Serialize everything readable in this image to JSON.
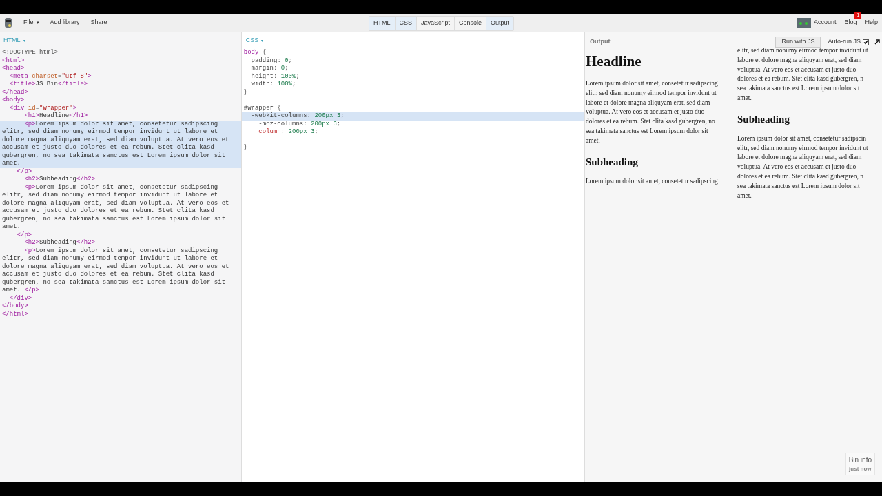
{
  "toolbar": {
    "menu": [
      {
        "label": "File",
        "caret": "▾"
      },
      {
        "label": "Add library"
      },
      {
        "label": "Share"
      }
    ],
    "tabs": [
      {
        "label": "HTML",
        "selected": true
      },
      {
        "label": "CSS",
        "selected": true
      },
      {
        "label": "JavaScript",
        "selected": false
      },
      {
        "label": "Console",
        "selected": false
      },
      {
        "label": "Output",
        "selected": true
      }
    ],
    "account": "Account",
    "blog": "Blog",
    "blog_badge": "1",
    "help": "Help"
  },
  "html_panel": {
    "title": "HTML",
    "caret": "▾",
    "lines": [
      {
        "highlighted": false,
        "tokens": [
          {
            "kind": "plain",
            "text": "<!DOCTYPE html>"
          }
        ]
      },
      {
        "highlighted": false,
        "tokens": [
          {
            "kind": "tag",
            "text": "<html>"
          }
        ]
      },
      {
        "highlighted": false,
        "tokens": [
          {
            "kind": "tag",
            "text": "<head>"
          }
        ]
      },
      {
        "highlighted": false,
        "tokens": [
          {
            "kind": "tag",
            "text": "  <meta "
          },
          {
            "kind": "attr",
            "text": "charset"
          },
          {
            "kind": "plain",
            "text": "="
          },
          {
            "kind": "string",
            "text": "\"utf-8\""
          },
          {
            "kind": "tag",
            "text": ">"
          }
        ]
      },
      {
        "highlighted": false,
        "tokens": [
          {
            "kind": "tag",
            "text": "  <title>"
          },
          {
            "kind": "text",
            "text": "JS Bin"
          },
          {
            "kind": "tag",
            "text": "</title>"
          }
        ]
      },
      {
        "highlighted": false,
        "tokens": [
          {
            "kind": "tag",
            "text": "</head>"
          }
        ]
      },
      {
        "highlighted": false,
        "tokens": [
          {
            "kind": "tag",
            "text": "<body>"
          }
        ]
      },
      {
        "highlighted": false,
        "tokens": [
          {
            "kind": "tag",
            "text": "  <div "
          },
          {
            "kind": "attr",
            "text": "id"
          },
          {
            "kind": "plain",
            "text": "="
          },
          {
            "kind": "string",
            "text": "\"wrapper\""
          },
          {
            "kind": "tag",
            "text": ">"
          }
        ]
      },
      {
        "highlighted": false,
        "tokens": [
          {
            "kind": "tag",
            "text": "      <h1>"
          },
          {
            "kind": "text",
            "text": "Headline"
          },
          {
            "kind": "tag",
            "text": "</h1>"
          }
        ]
      },
      {
        "highlighted": true,
        "tokens": [
          {
            "kind": "tag",
            "text": "      <p>"
          },
          {
            "kind": "text",
            "text": "Lorem ipsum dolor sit amet, consetetur sadipscing"
          }
        ]
      },
      {
        "highlighted": true,
        "tokens": [
          {
            "kind": "text",
            "text": "elitr, sed diam nonumy eirmod tempor invidunt ut labore et"
          }
        ]
      },
      {
        "highlighted": true,
        "tokens": [
          {
            "kind": "text",
            "text": "dolore magna aliquyam erat, sed diam voluptua. At vero eos et"
          }
        ]
      },
      {
        "highlighted": true,
        "tokens": [
          {
            "kind": "text",
            "text": "accusam et justo duo dolores et ea rebum. Stet clita kasd"
          }
        ]
      },
      {
        "highlighted": true,
        "tokens": [
          {
            "kind": "text",
            "text": "gubergren, no sea takimata sanctus est Lorem ipsum dolor sit"
          }
        ]
      },
      {
        "highlighted": true,
        "tokens": [
          {
            "kind": "text",
            "text": "amet."
          }
        ]
      },
      {
        "highlighted": false,
        "tokens": [
          {
            "kind": "tag",
            "text": "    </p>"
          }
        ]
      },
      {
        "highlighted": false,
        "tokens": [
          {
            "kind": "tag",
            "text": "      <h2>"
          },
          {
            "kind": "text",
            "text": "Subheading"
          },
          {
            "kind": "tag",
            "text": "</h2>"
          }
        ]
      },
      {
        "highlighted": false,
        "tokens": [
          {
            "kind": "tag",
            "text": "      <p>"
          },
          {
            "kind": "text",
            "text": "Lorem ipsum dolor sit amet, consetetur sadipscing"
          }
        ]
      },
      {
        "highlighted": false,
        "tokens": [
          {
            "kind": "text",
            "text": "elitr, sed diam nonumy eirmod tempor invidunt ut labore et"
          }
        ]
      },
      {
        "highlighted": false,
        "tokens": [
          {
            "kind": "text",
            "text": "dolore magna aliquyam erat, sed diam voluptua. At vero eos et"
          }
        ]
      },
      {
        "highlighted": false,
        "tokens": [
          {
            "kind": "text",
            "text": "accusam et justo duo dolores et ea rebum. Stet clita kasd"
          }
        ]
      },
      {
        "highlighted": false,
        "tokens": [
          {
            "kind": "text",
            "text": "gubergren, no sea takimata sanctus est Lorem ipsum dolor sit"
          }
        ]
      },
      {
        "highlighted": false,
        "tokens": [
          {
            "kind": "text",
            "text": "amet."
          }
        ]
      },
      {
        "highlighted": false,
        "tokens": [
          {
            "kind": "tag",
            "text": "    </p>"
          }
        ]
      },
      {
        "highlighted": false,
        "tokens": [
          {
            "kind": "tag",
            "text": "      <h2>"
          },
          {
            "kind": "text",
            "text": "Subheading"
          },
          {
            "kind": "tag",
            "text": "</h2>"
          }
        ]
      },
      {
        "highlighted": false,
        "tokens": [
          {
            "kind": "tag",
            "text": "      <p>"
          },
          {
            "kind": "text",
            "text": "Lorem ipsum dolor sit amet, consetetur sadipscing"
          }
        ]
      },
      {
        "highlighted": false,
        "tokens": [
          {
            "kind": "text",
            "text": "elitr, sed diam nonumy eirmod tempor invidunt ut labore et"
          }
        ]
      },
      {
        "highlighted": false,
        "tokens": [
          {
            "kind": "text",
            "text": "dolore magna aliquyam erat, sed diam voluptua. At vero eos et"
          }
        ]
      },
      {
        "highlighted": false,
        "tokens": [
          {
            "kind": "text",
            "text": "accusam et justo duo dolores et ea rebum. Stet clita kasd"
          }
        ]
      },
      {
        "highlighted": false,
        "tokens": [
          {
            "kind": "text",
            "text": "gubergren, no sea takimata sanctus est Lorem ipsum dolor sit"
          }
        ]
      },
      {
        "highlighted": false,
        "tokens": [
          {
            "kind": "text",
            "text": "amet. "
          },
          {
            "kind": "tag",
            "text": "</p>"
          }
        ]
      },
      {
        "highlighted": false,
        "tokens": [
          {
            "kind": "tag",
            "text": "  </div>"
          }
        ]
      },
      {
        "highlighted": false,
        "tokens": [
          {
            "kind": "tag",
            "text": "</body>"
          }
        ]
      },
      {
        "highlighted": false,
        "tokens": [
          {
            "kind": "tag",
            "text": "</html>"
          }
        ]
      }
    ]
  },
  "css_panel": {
    "title": "CSS",
    "caret": "▾",
    "lines": [
      {
        "highlighted": false,
        "tokens": [
          {
            "kind": "tag",
            "text": "body"
          },
          {
            "kind": "plain",
            "text": " {"
          }
        ]
      },
      {
        "highlighted": false,
        "tokens": [
          {
            "kind": "prop",
            "text": "  padding"
          },
          {
            "kind": "plain",
            "text": ": "
          },
          {
            "kind": "number",
            "text": "0"
          },
          {
            "kind": "plain",
            "text": ";"
          }
        ]
      },
      {
        "highlighted": false,
        "tokens": [
          {
            "kind": "prop",
            "text": "  margin"
          },
          {
            "kind": "plain",
            "text": ": "
          },
          {
            "kind": "number",
            "text": "0"
          },
          {
            "kind": "plain",
            "text": ";"
          }
        ]
      },
      {
        "highlighted": false,
        "tokens": [
          {
            "kind": "prop",
            "text": "  height"
          },
          {
            "kind": "plain",
            "text": ": "
          },
          {
            "kind": "number",
            "text": "100%"
          },
          {
            "kind": "plain",
            "text": ";"
          }
        ]
      },
      {
        "highlighted": false,
        "tokens": [
          {
            "kind": "prop",
            "text": "  width"
          },
          {
            "kind": "plain",
            "text": ": "
          },
          {
            "kind": "number",
            "text": "100%"
          },
          {
            "kind": "plain",
            "text": ";"
          }
        ]
      },
      {
        "highlighted": false,
        "tokens": [
          {
            "kind": "plain",
            "text": "}"
          }
        ]
      },
      {
        "kind": "blank"
      },
      {
        "highlighted": false,
        "tokens": [
          {
            "kind": "prop",
            "text": "#wrapper"
          },
          {
            "kind": "plain",
            "text": " {"
          }
        ]
      },
      {
        "highlighted": true,
        "tokens": [
          {
            "kind": "prop",
            "text": "  -webkit-columns"
          },
          {
            "kind": "plain",
            "text": ": "
          },
          {
            "kind": "number",
            "text": "200px 3"
          },
          {
            "kind": "plain",
            "text": ";"
          }
        ]
      },
      {
        "highlighted": false,
        "tokens": [
          {
            "kind": "prop",
            "text": "    -moz-columns"
          },
          {
            "kind": "plain",
            "text": ": "
          },
          {
            "kind": "number",
            "text": "200px 3"
          },
          {
            "kind": "plain",
            "text": ";"
          }
        ]
      },
      {
        "highlighted": false,
        "tokens": [
          {
            "kind": "error",
            "text": "    column"
          },
          {
            "kind": "plain",
            "text": ": "
          },
          {
            "kind": "number",
            "text": "200px 3"
          },
          {
            "kind": "plain",
            "text": ";"
          }
        ]
      },
      {
        "kind": "blank"
      },
      {
        "highlighted": false,
        "tokens": [
          {
            "kind": "plain",
            "text": "}"
          }
        ]
      }
    ]
  },
  "output_panel": {
    "title": "Output",
    "run_button": "Run with JS",
    "autorun": {
      "label": "Auto-run JS",
      "checked": true
    },
    "columns": [
      [
        {
          "kind": "h1",
          "lines": [
            "Headline"
          ]
        },
        {
          "kind": "p",
          "lines": [
            "Lorem ipsum dolor sit amet, consetetur sadipscing",
            "elitr, sed diam nonumy eirmod tempor invidunt ut",
            "labore et dolore magna aliquyam erat, sed diam",
            "voluptua. At vero eos et accusam et justo duo",
            "dolores et ea rebum. Stet clita kasd gubergren, no",
            "sea takimata sanctus est Lorem ipsum dolor sit",
            "amet."
          ]
        },
        {
          "kind": "h2",
          "lines": [
            "Subheading"
          ]
        },
        {
          "kind": "p",
          "lines": [
            "Lorem ipsum dolor sit amet, consetetur sadipscing"
          ]
        }
      ],
      [
        {
          "kind": "p",
          "lines": [
            "elitr, sed diam nonumy eirmod tempor invidunt ut",
            "labore et dolore magna aliquyam erat, sed diam",
            "voluptua. At vero eos et accusam et justo duo",
            "dolores et ea rebum. Stet clita kasd gubergren, n",
            "sea takimata sanctus est Lorem ipsum dolor sit",
            "amet."
          ]
        },
        {
          "kind": "h2",
          "lines": [
            "Subheading"
          ]
        },
        {
          "kind": "p",
          "lines": [
            "Lorem ipsum dolor sit amet, consetetur sadipscin",
            "elitr, sed diam nonumy eirmod tempor invidunt ut",
            "labore et dolore magna aliquyam erat, sed diam",
            "voluptua. At vero eos et accusam et justo duo",
            "dolores et ea rebum. Stet clita kasd gubergren, n",
            "sea takimata sanctus est Lorem ipsum dolor sit",
            "amet."
          ]
        }
      ]
    ],
    "bin_info": {
      "title": "Bin info",
      "time": "just now"
    }
  }
}
